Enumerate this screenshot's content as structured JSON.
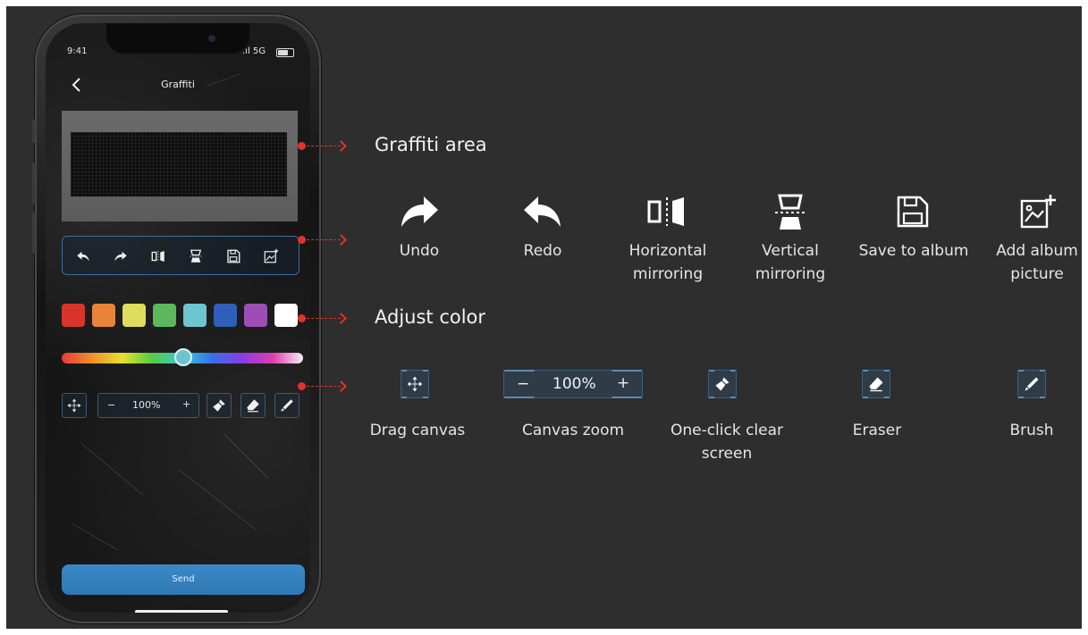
{
  "phone": {
    "status_time": "9:41",
    "status_signal": ".ıl 5G",
    "title": "Graffiti",
    "swatches": [
      "#d9342b",
      "#e8843a",
      "#dfdc5e",
      "#5cb85c",
      "#6cc6cf",
      "#2f5fb8",
      "#9b4fb6",
      "#ffffff"
    ],
    "zoom_value": "100%",
    "zoom_minus": "−",
    "zoom_plus": "+",
    "send_label": "Send"
  },
  "annotations": {
    "graffiti_area": "Graffiti area",
    "adjust_color": "Adjust color"
  },
  "toolbar_features": [
    {
      "icon": "undo-icon",
      "label": "Undo"
    },
    {
      "icon": "redo-icon",
      "label": "Redo"
    },
    {
      "icon": "horizontal-mirror-icon",
      "label": "Horizontal mirroring"
    },
    {
      "icon": "vertical-mirror-icon",
      "label": "Vertical mirroring"
    },
    {
      "icon": "save-icon",
      "label": "Save to album"
    },
    {
      "icon": "add-picture-icon",
      "label": "Add album picture"
    }
  ],
  "tool_features": [
    {
      "icon": "drag-icon",
      "label": "Drag canvas"
    },
    {
      "icon": "zoom-control",
      "label": "Canvas zoom",
      "value": "100%",
      "minus": "−",
      "plus": "+"
    },
    {
      "icon": "clear-brush-icon",
      "label": "One-click clear screen"
    },
    {
      "icon": "eraser-icon",
      "label": "Eraser"
    },
    {
      "icon": "brush-icon",
      "label": "Brush"
    }
  ],
  "colors": {
    "background": "#2e2e2e",
    "accent_red": "#e0332c",
    "send_blue": "#2f78b4"
  }
}
